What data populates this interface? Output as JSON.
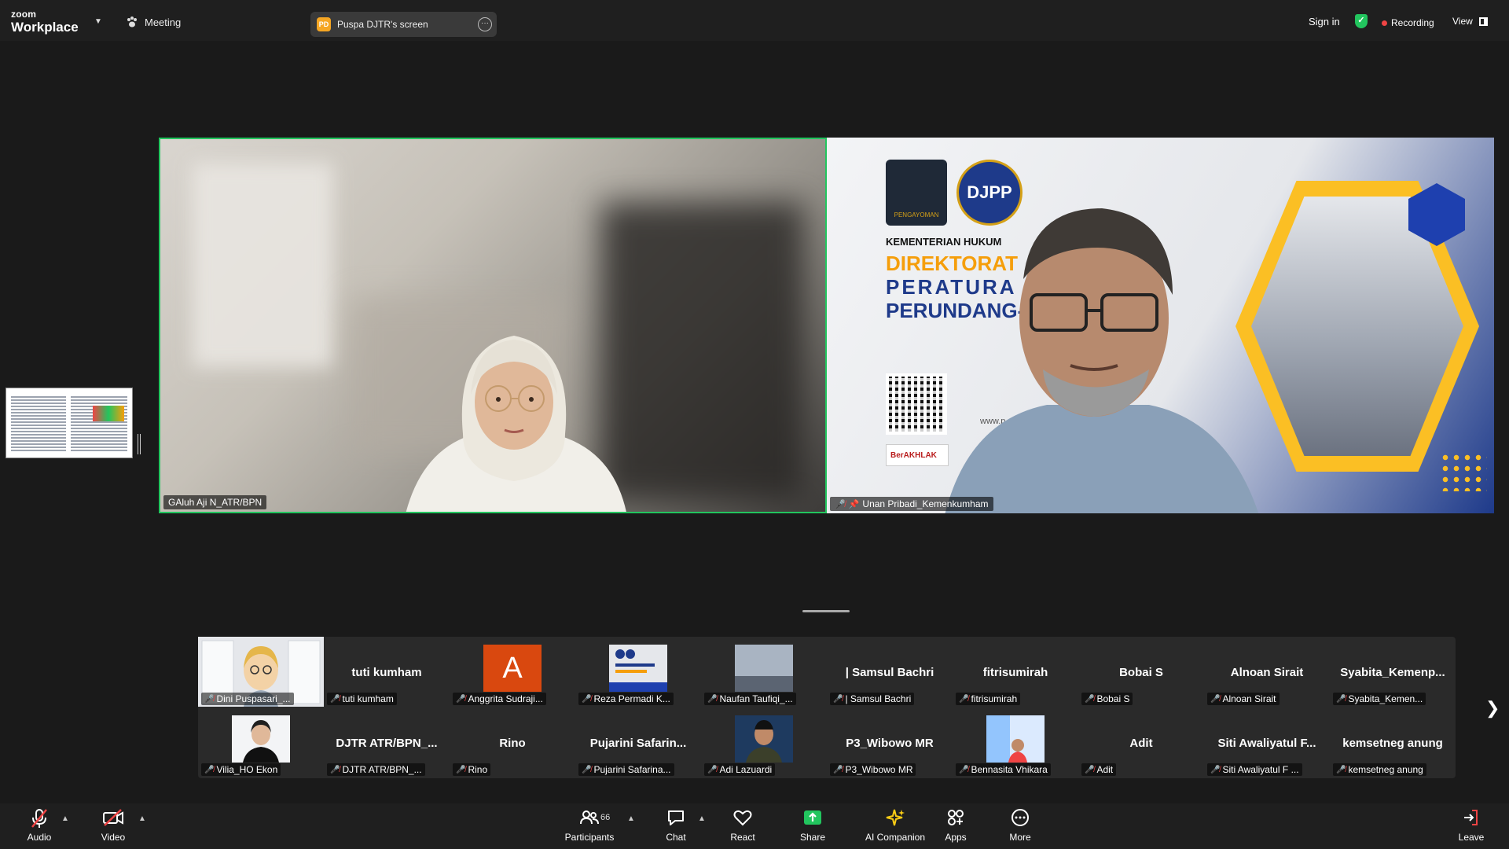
{
  "topbar": {
    "brand_small": "zoom",
    "brand_big": "Workplace",
    "meeting_label": "Meeting",
    "share_badge": "PD",
    "share_title": "Puspa DJTR's screen",
    "signin": "Sign in",
    "recording": "Recording",
    "view": "View"
  },
  "videos": {
    "left_name": "GAluh Aji N_ATR/BPN",
    "right_name": "Unan Pribadi_Kemenkumham",
    "slide": {
      "logo_text": "PENGAYOMAN",
      "djpp": "DJPP",
      "line1": "KEMENTERIAN HUKUM",
      "line2": "DIREKTORAT",
      "line3": "PERATURA",
      "line4": "PERUNDANG-U",
      "badge": "BerAKHLAK",
      "url": "www.p"
    }
  },
  "gallery": {
    "row1": [
      {
        "name": "",
        "label": "Dini Puspasari_...",
        "type": "avatar3d"
      },
      {
        "name": "tuti kumham",
        "label": "tuti kumham",
        "type": "text"
      },
      {
        "name": "",
        "label": "Anggrita Sudraji...",
        "type": "letter",
        "letter": "A"
      },
      {
        "name": "",
        "label": "Reza Permadi K...",
        "type": "slide"
      },
      {
        "name": "",
        "label": "Naufan Taufiqi_...",
        "type": "sky"
      },
      {
        "name": "| Samsul Bachri",
        "label": "| Samsul Bachri",
        "type": "text"
      },
      {
        "name": "fitrisumirah",
        "label": "fitrisumirah",
        "type": "text"
      },
      {
        "name": "Bobai S",
        "label": "Bobai S",
        "type": "text"
      },
      {
        "name": "Alnoan Sirait",
        "label": "Alnoan Sirait",
        "type": "text"
      },
      {
        "name": "Syabita_Kemenp...",
        "label": "Syabita_Kemen...",
        "type": "text"
      }
    ],
    "row2": [
      {
        "name": "",
        "label": "Vilia_HO Ekon",
        "type": "photo"
      },
      {
        "name": "DJTR ATR/BPN_...",
        "label": "DJTR ATR/BPN_...",
        "type": "text"
      },
      {
        "name": "Rino",
        "label": "Rino",
        "type": "text"
      },
      {
        "name": "Pujarini Safarin...",
        "label": "Pujarini Safarina...",
        "type": "text"
      },
      {
        "name": "",
        "label": "Adi Lazuardi",
        "type": "photo2"
      },
      {
        "name": "P3_Wibowo MR",
        "label": "P3_Wibowo MR",
        "type": "text"
      },
      {
        "name": "",
        "label": "Bennasita Vhikara",
        "type": "photo3"
      },
      {
        "name": "Adit",
        "label": "Adit",
        "type": "text"
      },
      {
        "name": "Siti Awaliyatul F...",
        "label": "Siti Awaliyatul F ...",
        "type": "text"
      },
      {
        "name": "kemsetneg anung",
        "label": "kemsetneg anung",
        "type": "text"
      }
    ]
  },
  "toolbar": {
    "audio": "Audio",
    "video": "Video",
    "participants": "Participants",
    "participants_count": "66",
    "chat": "Chat",
    "react": "React",
    "share": "Share",
    "ai": "AI Companion",
    "apps": "Apps",
    "more": "More",
    "leave": "Leave"
  },
  "colors": {
    "active_speaker": "#22c55e",
    "recording_dot": "#ef4444",
    "share_green": "#22c55e"
  }
}
